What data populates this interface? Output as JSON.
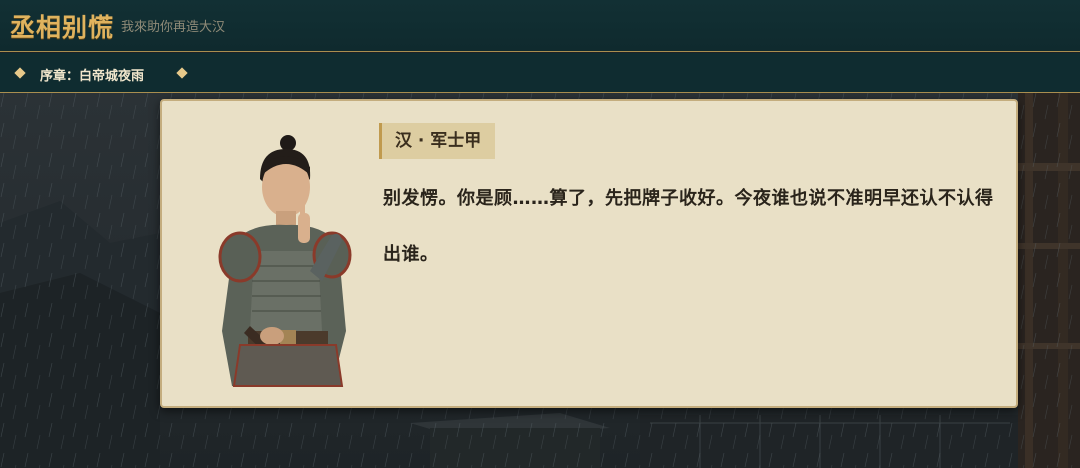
{
  "header": {
    "game_title": "丞相别慌",
    "subtitle": "我來助你再造大汉"
  },
  "chapter": {
    "title": "序章：白帝城夜雨"
  },
  "dialog": {
    "speaker": "汉 · 军士甲",
    "text": "别发愣。你是顾……算了，先把牌子收好。今夜谁也说不准明早还认不认得出谁。"
  },
  "colors": {
    "title_gold": "#e0b35e",
    "header_teal": "#123034",
    "parchment": "#e9e0c6"
  }
}
